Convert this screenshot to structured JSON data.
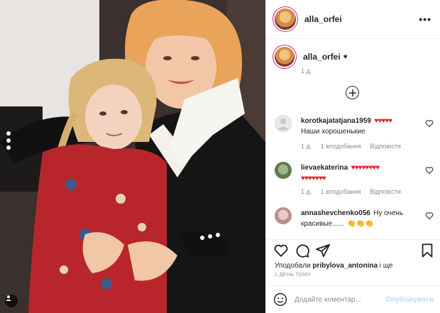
{
  "post": {
    "username": "alla_orfei",
    "caption_heart": "♥",
    "caption_time": "1 д."
  },
  "header": {
    "more_label": "•••"
  },
  "comments": [
    {
      "username": "korotkajatatjana1959",
      "hearts": "♥♥♥♥♥",
      "text": "Наши хорошенькие",
      "time": "1 д.",
      "likes": "1 вподобання",
      "reply": "Відповісти"
    },
    {
      "username": "lievaekaterina",
      "hearts": "♥♥♥♥♥♥♥♥",
      "hearts2": "♥♥♥♥♥♥♥",
      "text": "",
      "time": "1 д.",
      "likes": "1 вподобання",
      "reply": "Відповісти"
    },
    {
      "username": "annashevchenko056",
      "text": "Ну очень красивые......",
      "emoji": "👏👏👏",
      "time": "",
      "likes": "",
      "reply": ""
    }
  ],
  "likes_prefix": "Уподобали",
  "likes_user": "pribylova_antonina",
  "likes_suffix": "і ще",
  "ago": "1 ДЕНЬ ТОМУ",
  "comment_input": {
    "placeholder": "Додайте коментар...",
    "value": ""
  },
  "publish_label": "Опублікувати",
  "icons": {
    "heart": "heart-icon",
    "comment": "comment-icon",
    "share": "share-icon",
    "save": "bookmark-icon",
    "emoji": "emoji-icon",
    "more": "more-options-icon",
    "plus": "load-more-icon"
  },
  "colors": {
    "accent_heart": "#ed1c24",
    "publish_disabled": "#b2dffc",
    "meta_gray": "#8e8e8e"
  }
}
